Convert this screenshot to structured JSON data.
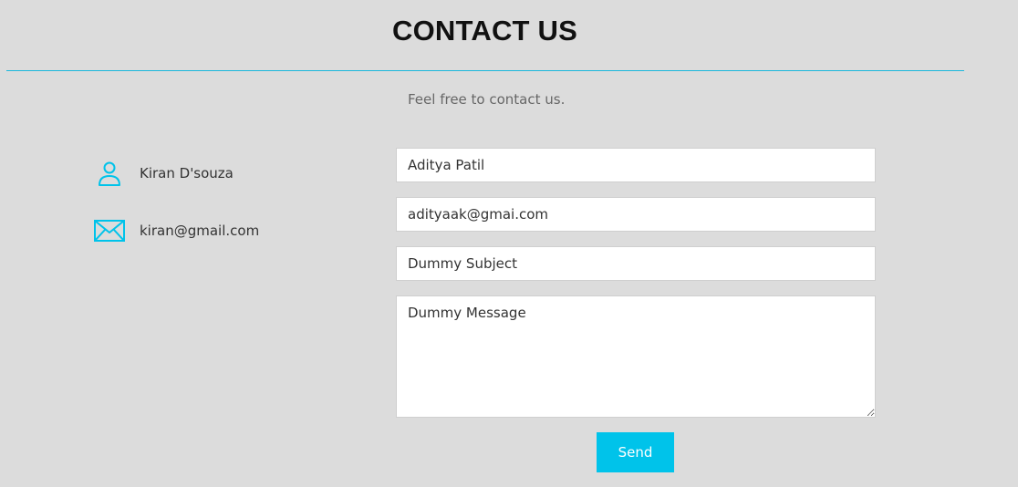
{
  "header": {
    "title": "CONTACT US",
    "subtitle": "Feel free to contact us."
  },
  "contact_info": {
    "name": "Kiran D'souza",
    "name_icon": "user-icon",
    "email": "kiran@gmail.com",
    "email_icon": "envelope-icon"
  },
  "form": {
    "name_value": "Aditya Patil",
    "email_value": "adityaak@gmai.com",
    "subject_value": "Dummy Subject",
    "message_value": "Dummy Message",
    "send_label": "Send"
  },
  "colors": {
    "background": "#dcdcdc",
    "accent": "#00c3ea",
    "divider": "#1bb8dc"
  }
}
